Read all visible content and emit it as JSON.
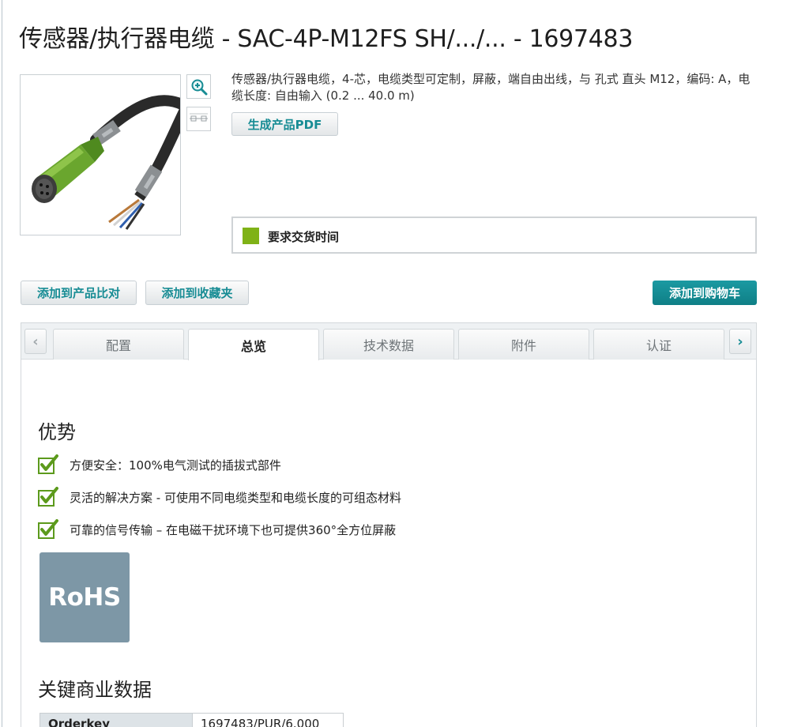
{
  "product": {
    "title": "传感器/执行器电缆 - SAC-4P-M12FS SH/.../... - 1697483",
    "description": "传感器/执行器电缆，4-芯，电缆类型可定制，屏蔽，端自由出线，与 孔式 直头 M12，编码: A，电缆长度: 自由输入 (0.2 ... 40.0 m)",
    "pdf_button": "生成产品PDF",
    "delivery_label": "要求交货时间",
    "delivery_color": "#7fb217"
  },
  "actions": {
    "compare": "添加到产品比对",
    "favorite": "添加到收藏夹",
    "cart": "添加到购物车"
  },
  "tabs": [
    {
      "label": "配置",
      "active": false
    },
    {
      "label": "总览",
      "active": true
    },
    {
      "label": "技术数据",
      "active": false
    },
    {
      "label": "附件",
      "active": false
    },
    {
      "label": "认证",
      "active": false
    }
  ],
  "advantages": {
    "heading": "优势",
    "items": [
      "方便安全：100%电气测试的插拔式部件",
      "灵活的解决方案 - 可使用不同电缆类型和电缆长度的可组态材料",
      "可靠的信号传输 – 在电磁干扰环境下也可提供360°全方位屏蔽"
    ]
  },
  "rohs_logo": "RoHS",
  "business_data": {
    "heading": "关键商业数据",
    "rows": [
      {
        "key": "Orderkey",
        "value": "1697483/PUR/6.000"
      }
    ]
  },
  "icons": {
    "zoom": "zoom-in-icon",
    "prev": "chevron-left-icon",
    "next": "chevron-right-icon",
    "check": "green-checkmark-icon"
  },
  "colors": {
    "accent": "#178c94",
    "cart_button": "#138a91",
    "rohs_bg": "#7d97a6"
  }
}
